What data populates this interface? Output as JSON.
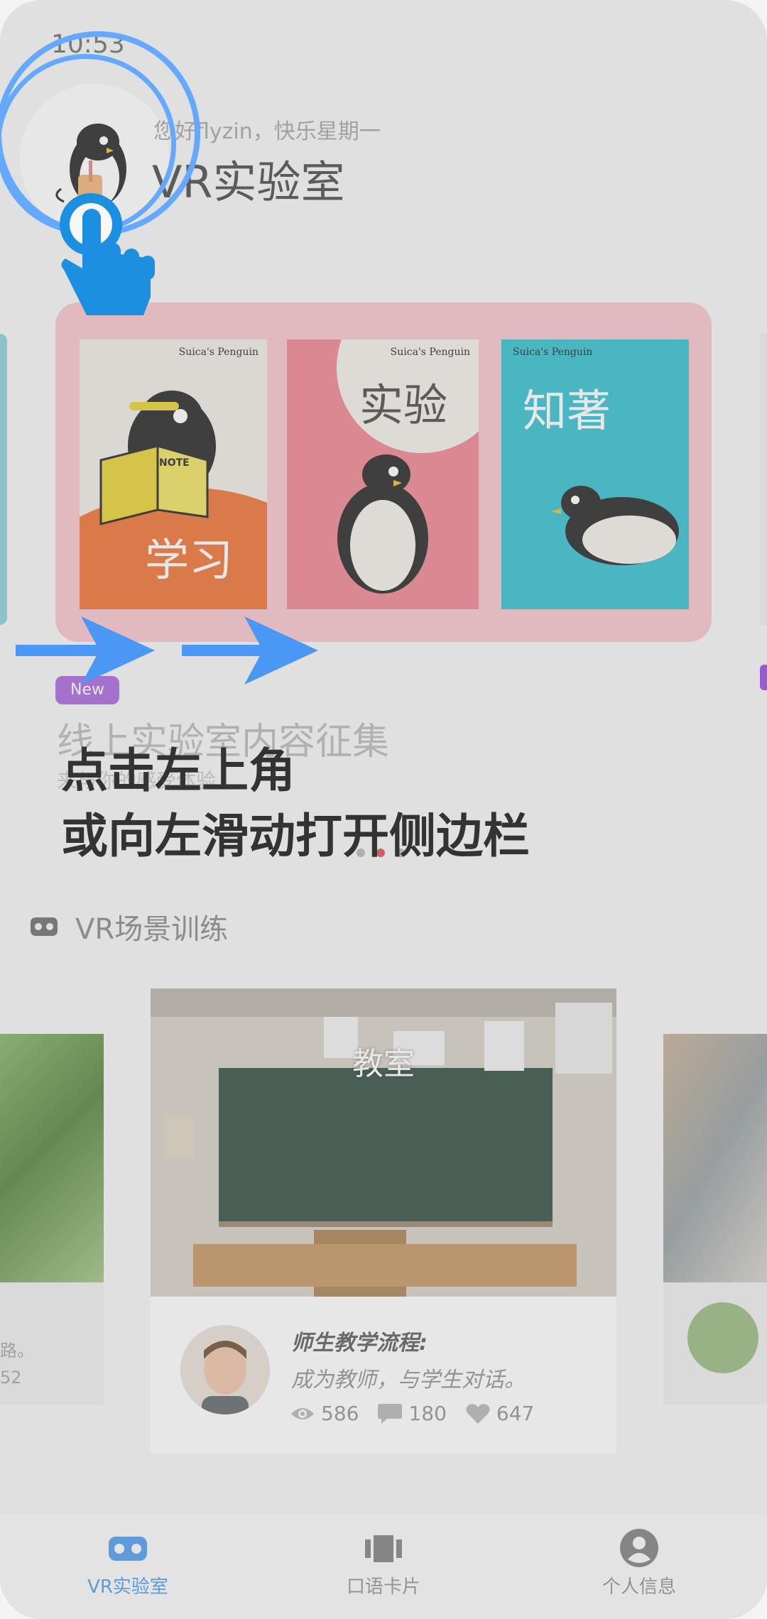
{
  "status_bar": {
    "time": "10:53"
  },
  "header": {
    "greeting": "您好flyzin，快乐星期一",
    "title": "VR实验室"
  },
  "banner": {
    "books": [
      {
        "brand": "Suica's Penguin",
        "word": "学习",
        "note": "NOTE"
      },
      {
        "brand": "Suica's Penguin",
        "word": "实验"
      },
      {
        "brand": "Suica's Penguin",
        "word": "知著"
      }
    ],
    "badge": "New",
    "promo_title": "线上实验室内容征集",
    "promo_subtitle": "来与你的感受体验"
  },
  "carousel": {
    "dots": 3,
    "active_index": 1
  },
  "section": {
    "title": "VR场景训练",
    "icon": "vr-headset-icon"
  },
  "cards": {
    "left": {
      "line1": "路。",
      "line2": "52"
    },
    "main": {
      "room_label": "教室",
      "title": "师生教学流程:",
      "description": "成为教师，与学生对话。",
      "views": "586",
      "comments": "180",
      "likes": "647"
    }
  },
  "bottom_nav": {
    "items": [
      {
        "label": "VR实验室",
        "icon": "vr-headset-icon",
        "active": true
      },
      {
        "label": "口语卡片",
        "icon": "cards-icon",
        "active": false
      },
      {
        "label": "个人信息",
        "icon": "person-icon",
        "active": false
      }
    ]
  },
  "overlay": {
    "hint_line1": "点击左上角",
    "hint_line2": "或向左滑动打开侧边栏"
  },
  "colors": {
    "accent": "#5aa3f0",
    "overlay_blue": "#64a8ff",
    "badge_purple": "#b070e0",
    "banner_pink": "#f8c9cf",
    "inactive_nav": "#9a9a9a"
  }
}
